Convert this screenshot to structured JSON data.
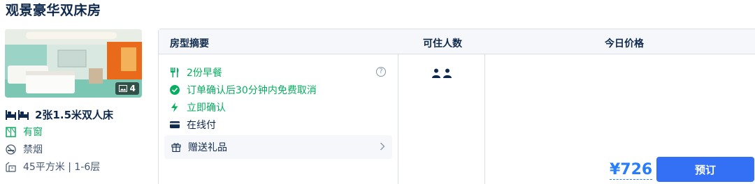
{
  "room": {
    "title": "观景豪华双床房",
    "photo_count": "4",
    "bed": "2张1.5米双人床",
    "facilities": [
      {
        "icon": "window-icon",
        "text": "有窗",
        "color": "#06ae5f"
      },
      {
        "icon": "no-smoking-icon",
        "text": "禁烟",
        "color": "#455873"
      },
      {
        "icon": "area-icon",
        "text": "45平方米 | 1-6层",
        "color": "#455873"
      }
    ]
  },
  "table": {
    "headers": {
      "summary": "房型摘要",
      "guests": "可住人数",
      "price": "今日价格"
    },
    "policies": [
      {
        "icon": "breakfast-icon",
        "text": "2份早餐",
        "color": "#06ae5f"
      },
      {
        "icon": "check-circle-icon",
        "text": "订单确认后30分钟内免费取消",
        "color": "#06ae5f"
      },
      {
        "icon": "lightning-icon",
        "text": "立即确认",
        "color": "#06ae5f"
      },
      {
        "icon": "card-icon",
        "text": "在线付",
        "color": "#0f294d"
      }
    ],
    "help_icon": "?",
    "gift": "赠送礼品",
    "guest_count": 2,
    "price": "¥726",
    "book_label": "预订"
  },
  "colors": {
    "primary": "#3470f5",
    "price": "#287dfa",
    "green": "#06ae5f",
    "text": "#0f294d"
  }
}
